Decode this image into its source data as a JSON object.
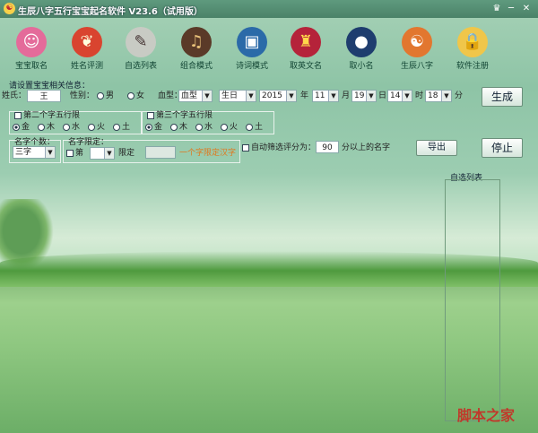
{
  "window": {
    "title": "生辰八字五行宝宝起名软件 V23.6（试用版）",
    "controls": {
      "skin": "♛",
      "minimize": "─",
      "close": "✕"
    }
  },
  "toolbar": {
    "items": [
      {
        "label": "宝宝取名",
        "icon": "baby-icon"
      },
      {
        "label": "姓名评测",
        "icon": "rooster-icon"
      },
      {
        "label": "自选列表",
        "icon": "brush-icon"
      },
      {
        "label": "组合模式",
        "icon": "guitar-icon"
      },
      {
        "label": "诗词模式",
        "icon": "book-icon"
      },
      {
        "label": "取英文名",
        "icon": "crest-icon"
      },
      {
        "label": "取小名",
        "icon": "penguin-icon"
      },
      {
        "label": "生辰八字",
        "icon": "bagua-icon"
      },
      {
        "label": "软件注册",
        "icon": "lock-icon"
      }
    ]
  },
  "form": {
    "section_label": "请设置宝宝相关信息：",
    "surname_label": "姓氏：",
    "surname_value": "王",
    "gender_label": "性别：",
    "male": "男",
    "female": "女",
    "blood_label": "血型：",
    "blood_value": "血型",
    "birth_type": "生日",
    "year": "2015",
    "year_unit": "年",
    "month": "11",
    "month_unit": "月",
    "day": "19",
    "day_unit": "日",
    "hour": "14",
    "hour_unit": "时",
    "minute": "18",
    "minute_unit": "分",
    "generate_button": "生成",
    "second_char_label": "第二个字五行限",
    "third_char_label": "第三个字五行限",
    "elements": [
      "金",
      "木",
      "水",
      "火",
      "土"
    ],
    "name_count_label": "名字个数：",
    "name_count_value": "三字",
    "name_limit_label": "名字限定：",
    "limit_pos": "第",
    "limit_word": "限定",
    "limit_hint": "一个字限定汉字",
    "auto_filter_label": "自动筛选评分为：",
    "score_value": "90",
    "score_suffix": "分以上的名字",
    "export_button": "导出",
    "stop_button": "停止",
    "selected_list_label": "自选列表"
  },
  "watermark": "脚本之家"
}
